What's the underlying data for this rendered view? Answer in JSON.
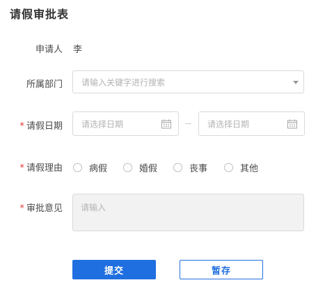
{
  "page": {
    "title": "请假审批表"
  },
  "form": {
    "applicant": {
      "label": "申请人",
      "value": "李"
    },
    "department": {
      "label": "所属部门",
      "placeholder": "请输入关键字进行搜索"
    },
    "leave_date": {
      "required_mark": "*",
      "label": "请假日期",
      "start_placeholder": "请选择日期",
      "end_placeholder": "请选择日期",
      "icon": "calendar-icon"
    },
    "leave_reason": {
      "required_mark": "*",
      "label": "请假理由",
      "options": [
        "病假",
        "婚假",
        "丧事",
        "其他"
      ]
    },
    "approval_opinion": {
      "required_mark": "*",
      "label": "审批意见",
      "placeholder": "请输入"
    }
  },
  "actions": {
    "submit_label": "提交",
    "draft_label": "暂存"
  },
  "colors": {
    "accent": "#1f6fe0",
    "required": "#e53935",
    "border": "#d9d9d9",
    "placeholder": "#b3b3b3",
    "disabled_bg": "#f2f2f2"
  }
}
